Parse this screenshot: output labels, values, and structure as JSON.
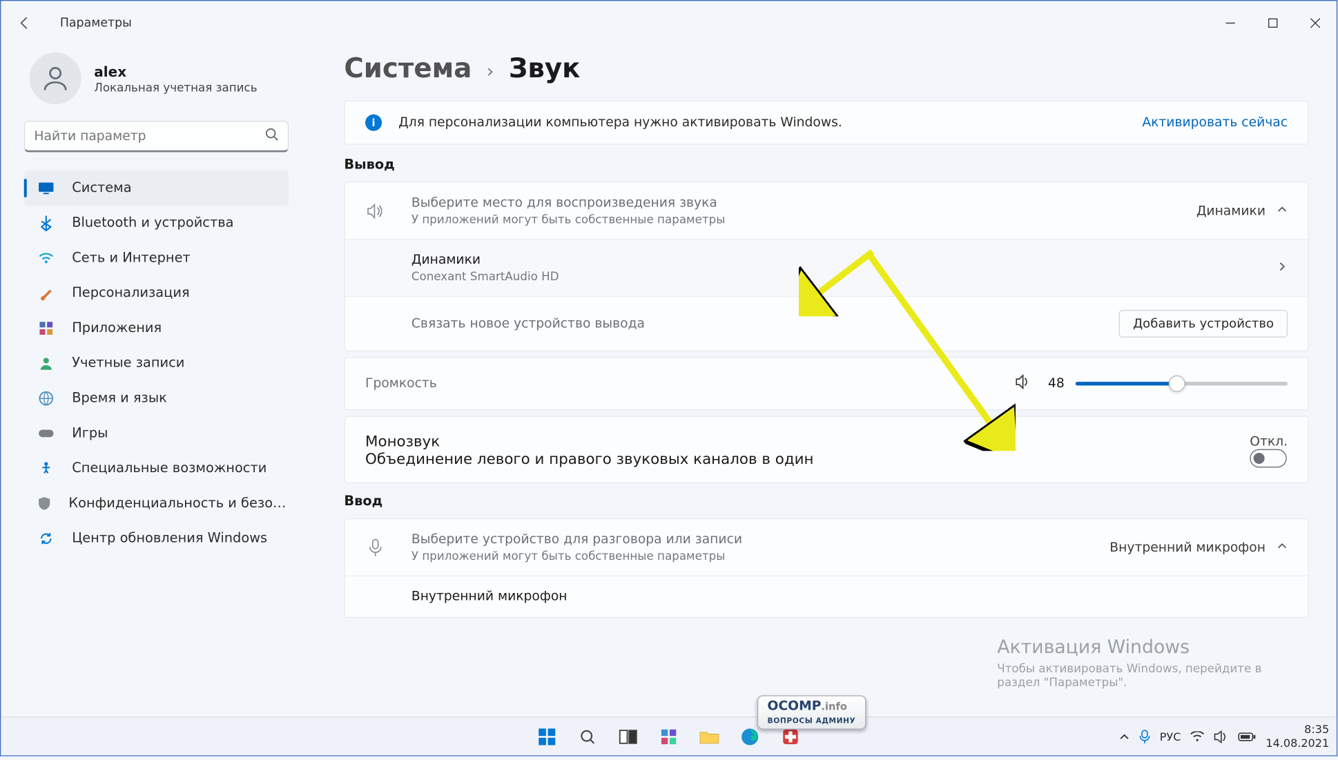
{
  "window": {
    "title": "Параметры",
    "back_label": "Назад"
  },
  "user": {
    "name": "alex",
    "subtitle": "Локальная учетная запись"
  },
  "search": {
    "placeholder": "Найти параметр"
  },
  "nav": {
    "items": [
      {
        "label": "Система",
        "icon": "display",
        "selected": true
      },
      {
        "label": "Bluetooth и устройства",
        "icon": "bluetooth"
      },
      {
        "label": "Сеть и Интернет",
        "icon": "wifi"
      },
      {
        "label": "Персонализация",
        "icon": "brush"
      },
      {
        "label": "Приложения",
        "icon": "apps"
      },
      {
        "label": "Учетные записи",
        "icon": "person"
      },
      {
        "label": "Время и язык",
        "icon": "globe"
      },
      {
        "label": "Игры",
        "icon": "gamepad"
      },
      {
        "label": "Специальные возможности",
        "icon": "accessibility"
      },
      {
        "label": "Конфиденциальность и безопасность",
        "icon": "shield"
      },
      {
        "label": "Центр обновления Windows",
        "icon": "update"
      }
    ]
  },
  "breadcrumb": {
    "parent": "Система",
    "current": "Звук"
  },
  "banner": {
    "text": "Для персонализации компьютера нужно активировать Windows.",
    "action": "Активировать сейчас"
  },
  "output": {
    "section_title": "Вывод",
    "select_title": "Выберите место для воспроизведения звука",
    "select_sub": "У приложений могут быть собственные параметры",
    "select_value": "Динамики",
    "device_name": "Динамики",
    "device_sub": "Conexant SmartAudio HD",
    "pair_title": "Связать новое устройство вывода",
    "pair_button": "Добавить устройство",
    "volume_title": "Громкость",
    "volume_value": "48",
    "volume_percent": 48,
    "mono_title": "Монозвук",
    "mono_sub": "Объединение левого и правого звуковых каналов в один",
    "mono_state": "Откл."
  },
  "input": {
    "section_title": "Ввод",
    "select_title": "Выберите устройство для разговора или записи",
    "select_sub": "У приложений могут быть собственные параметры",
    "select_value": "Внутренний микрофон",
    "device_name": "Внутренний микрофон"
  },
  "watermark": {
    "title": "Активация Windows",
    "sub": "Чтобы активировать Windows, перейдите в раздел \"Параметры\"."
  },
  "tray": {
    "lang": "РУС",
    "time": "8:35",
    "date": "14.08.2021"
  },
  "overlay_logo": "OCOMP.info ВОПРОСЫ АДМИНУ"
}
